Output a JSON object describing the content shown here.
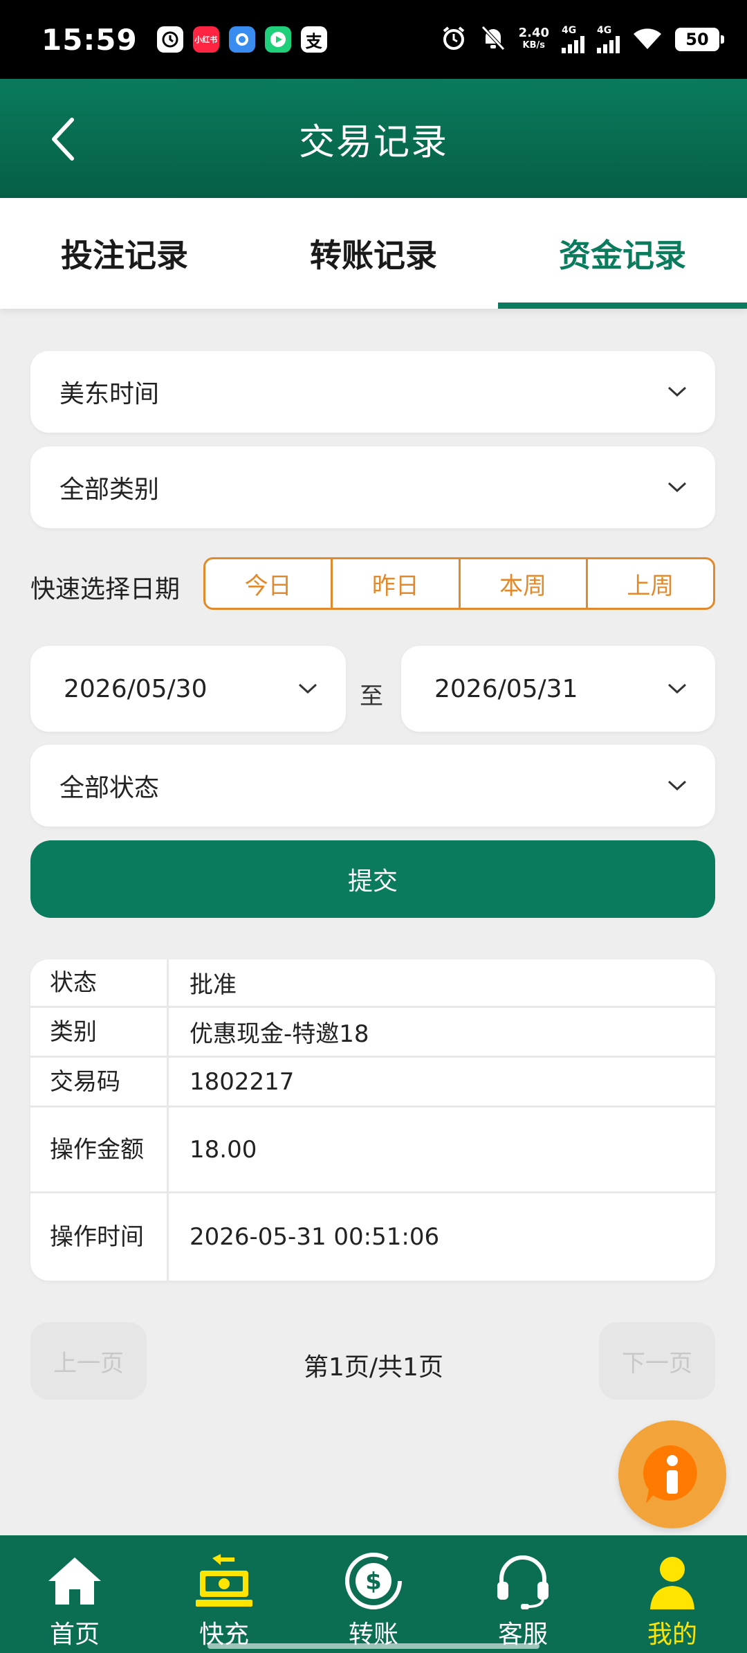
{
  "status_bar": {
    "time": "15:59",
    "apps": [
      {
        "icon": "clock-app-icon",
        "label": "",
        "bg": "#ffffff",
        "fg": "#000000"
      },
      {
        "icon": "xiaohongshu-icon",
        "label": "小红书",
        "bg": "#ff2442",
        "fg": "#ffffff"
      },
      {
        "icon": "app-blue-icon",
        "label": "",
        "bg": "#3a8df0",
        "fg": "#ffffff"
      },
      {
        "icon": "play-app-icon",
        "label": "",
        "bg": "#1fcf7a",
        "fg": "#ffffff"
      },
      {
        "icon": "alipay-icon",
        "label": "支",
        "bg": "#ffffff",
        "fg": "#000000"
      }
    ],
    "speed_value": "2.40",
    "speed_unit": "KB/s",
    "net1": "4G",
    "net2": "4G",
    "battery": "50"
  },
  "header": {
    "title": "交易记录",
    "bg": "#0b7b5d"
  },
  "tabs": [
    {
      "label": "投注记录",
      "active": false
    },
    {
      "label": "转账记录",
      "active": false
    },
    {
      "label": "资金记录",
      "active": true
    }
  ],
  "filters": {
    "timezone": "美东时间",
    "category": "全部类别",
    "quick_label": "快速选择日期",
    "quick_options": [
      "今日",
      "昨日",
      "本周",
      "上周"
    ],
    "start_date": "2026/05/30",
    "to_label": "至",
    "end_date": "2026/05/31",
    "status": "全部状态",
    "submit_label": "提交"
  },
  "record": {
    "rows": [
      {
        "key": "状态",
        "value": "批准"
      },
      {
        "key": "类别",
        "value": "优惠现金-特邀18"
      },
      {
        "key": "交易码",
        "value": "1802217"
      },
      {
        "key": "操作金额",
        "value": "18.00"
      },
      {
        "key": "操作时间",
        "value": "2026-05-31 00:51:06"
      }
    ]
  },
  "pagination": {
    "prev_label": "上一页",
    "info": "第1页/共1页",
    "next_label": "下一页"
  },
  "bottom_nav": [
    {
      "label": "首页",
      "icon": "home-icon",
      "active": false
    },
    {
      "label": "快充",
      "icon": "recharge-icon",
      "active": false
    },
    {
      "label": "转账",
      "icon": "transfer-icon",
      "active": false
    },
    {
      "label": "客服",
      "icon": "headset-icon",
      "active": false
    },
    {
      "label": "我的",
      "icon": "user-icon",
      "active": true
    }
  ],
  "colors": {
    "primary": "#0b7b5d",
    "accent_orange": "#e28a2b",
    "active_nav": "#ffe400",
    "fab": "#f2a33a"
  }
}
